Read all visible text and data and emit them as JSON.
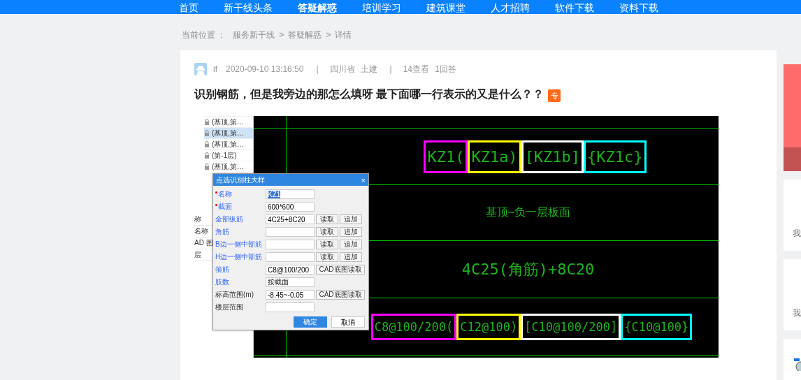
{
  "nav": [
    {
      "label": "首页",
      "selected": false
    },
    {
      "label": "新干线头条",
      "selected": false
    },
    {
      "label": "答疑解惑",
      "selected": true
    },
    {
      "label": "培训学习",
      "selected": false
    },
    {
      "label": "建筑课堂",
      "selected": false
    },
    {
      "label": "人才招聘",
      "selected": false
    },
    {
      "label": "软件下载",
      "selected": false
    },
    {
      "label": "资料下载",
      "selected": false
    }
  ],
  "breadcrumb": {
    "prefix": "当前位置 ：",
    "items": [
      "服务新干线",
      "答疑解惑",
      "详情"
    ],
    "separator": ">"
  },
  "question": {
    "author": "if",
    "time": "2020-09-10 13:16:50",
    "divider": "|",
    "region": "四川省",
    "category": "土建",
    "views": "14查看",
    "answers": "1回答",
    "title": "识别钢筋，但是我旁边的那怎么填呀 最下面哪一行表示的又是什么？？",
    "badge": "专"
  },
  "screenshot": {
    "tree_rows": [
      {
        "text": "(基顶,第…",
        "selected": false
      },
      {
        "text": "(基顶,第…",
        "selected": true
      },
      {
        "text": "(基顶,第…",
        "selected": false
      },
      {
        "text": "(第-1层)",
        "selected": false
      },
      {
        "text": "(基顶,第…",
        "selected": false
      }
    ],
    "panel_rows": [
      "称",
      "名称",
      "AD 图",
      "层"
    ],
    "dialog": {
      "title": "点选识别柱大样",
      "close": "×",
      "rows": [
        {
          "label": "名称",
          "required": true,
          "kind": "property",
          "value": "KZ1",
          "value_selected": true,
          "buttons": []
        },
        {
          "label": "截面",
          "required": true,
          "kind": "property",
          "value": "600*600",
          "value_selected": false,
          "buttons": []
        },
        {
          "label": "全部纵筋",
          "required": false,
          "kind": "property",
          "value": "4C25+8C20",
          "value_selected": false,
          "buttons": [
            "读取",
            "追加"
          ]
        },
        {
          "label": "角筋",
          "required": false,
          "kind": "property",
          "buttons": [
            "读取",
            "追加"
          ]
        },
        {
          "label": "B边一侧中部筋",
          "required": false,
          "kind": "property",
          "buttons": [
            "读取",
            "追加"
          ]
        },
        {
          "label": "H边一侧中部筋",
          "required": false,
          "kind": "property",
          "buttons": [
            "读取",
            "追加"
          ]
        },
        {
          "label": "箍筋",
          "required": false,
          "kind": "property",
          "value": "C8@100/200",
          "value_selected": false,
          "buttons": [
            "CAD底图读取"
          ]
        },
        {
          "label": "肢数",
          "required": false,
          "kind": "property",
          "value": "按截面",
          "value_selected": false,
          "buttons": []
        },
        {
          "label": "标高范围(m)",
          "required": false,
          "kind": "range",
          "value": "-8.45~-0.05",
          "value_selected": false,
          "buttons": [
            "CAD底图读取"
          ]
        },
        {
          "label": "楼层范围",
          "required": false,
          "kind": "range",
          "buttons": []
        }
      ],
      "ok": "确定",
      "cancel": "取消"
    },
    "cad": {
      "names": [
        {
          "text": "KZ1(",
          "color": "#ff00ff"
        },
        {
          "text": "KZ1a)",
          "color": "#ffff00"
        },
        {
          "text": "[KZ1b]",
          "color": "#ffffff"
        },
        {
          "text": "{KZ1c}",
          "color": "#00ffff"
        }
      ],
      "range": "基顶~负一层板面",
      "rebar": "4C25(角筋)+8C20",
      "stirrups": [
        {
          "text": "C8@100/200(",
          "color": "#ff00ff"
        },
        {
          "text": "C12@100)",
          "color": "#ffff00"
        },
        {
          "text": "[C10@100/200]",
          "color": "#ffffff"
        },
        {
          "text": "{C10@100}",
          "color": "#00ffff"
        }
      ]
    }
  },
  "sidebar": {
    "cards": [
      "我",
      "我"
    ]
  }
}
